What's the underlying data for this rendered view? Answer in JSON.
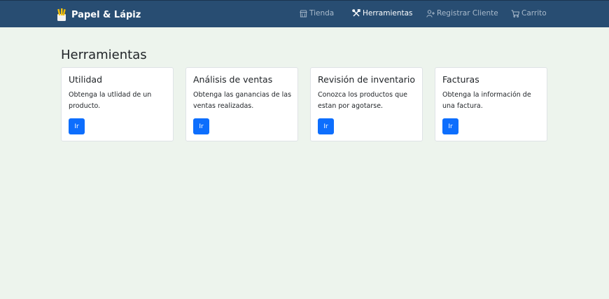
{
  "brand": {
    "name": "Papel & Lápiz",
    "logo_icon": "pencil-cup-icon"
  },
  "nav": {
    "items": [
      {
        "label": "Tienda",
        "icon": "store-icon",
        "active": false
      },
      {
        "label": "Herramientas",
        "icon": "tools-icon",
        "active": true
      },
      {
        "label": "Registrar Cliente",
        "icon": "person-add-icon",
        "active": false
      },
      {
        "label": "Carrito",
        "icon": "cart-icon",
        "active": false
      }
    ]
  },
  "main": {
    "title": "Herramientas",
    "cards": [
      {
        "title": "Utilidad",
        "text": "Obtenga la utlidad de un producto.",
        "button": "Ir"
      },
      {
        "title": "Análisis de ventas",
        "text": "Obtenga las ganancias de las ventas realizadas.",
        "button": "Ir"
      },
      {
        "title": "Revisión de inventario",
        "text": "Conozca los productos que estan por agotarse.",
        "button": "Ir"
      },
      {
        "title": "Facturas",
        "text": "Obtenga la información de una factura.",
        "button": "Ir"
      }
    ]
  },
  "colors": {
    "navbar": "#284d72",
    "background": "#edf4ed",
    "button": "#0d6efd",
    "nav_active": "#ffffff",
    "nav_inactive": "#a9bacb"
  }
}
